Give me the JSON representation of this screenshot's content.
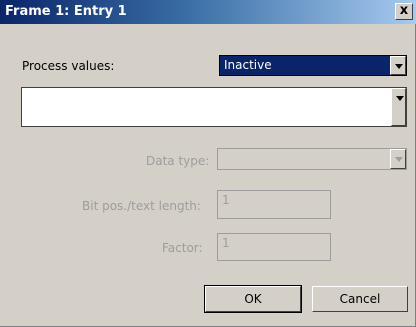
{
  "window": {
    "title": "Frame 1: Entry 1",
    "close_symbol": "x"
  },
  "process_values": {
    "label": "Process values:",
    "selected": "Inactive",
    "list_value": ""
  },
  "data_type": {
    "label": "Data type:",
    "value": ""
  },
  "bit_pos": {
    "label": "Bit pos./text length:",
    "value": "1"
  },
  "factor": {
    "label": "Factor:",
    "value": "1"
  },
  "buttons": {
    "ok": "OK",
    "cancel": "Cancel"
  }
}
